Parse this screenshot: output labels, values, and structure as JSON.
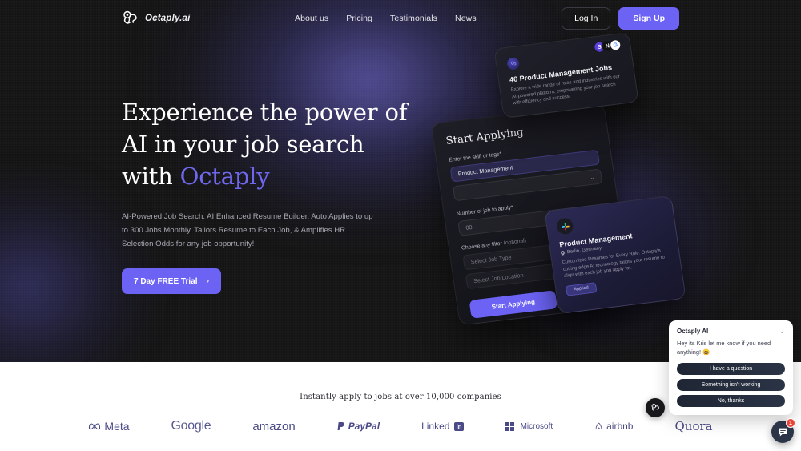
{
  "brand": {
    "name": "Octaply.ai",
    "logo_icon": "octopus-logo-icon"
  },
  "nav": {
    "links": [
      {
        "label": "About us"
      },
      {
        "label": "Pricing"
      },
      {
        "label": "Testimonials"
      },
      {
        "label": "News"
      }
    ],
    "login_label": "Log In",
    "signup_label": "Sign Up"
  },
  "hero": {
    "headline_line1": "Experience the power of",
    "headline_line2": "AI in your job search",
    "headline_line3_prefix": "with ",
    "headline_accent": "Octaply",
    "subcopy": "AI-Powered Job Search: AI Enhanced Resume Builder, Auto Applies to up to 300 Jobs Monthly, Tailors Resume to Each Job, & Amplifies HR Selection Odds for any job opportunity!",
    "cta_label": "7 Day FREE Trial",
    "cta_chevron": "›",
    "accent_color": "#6c63f5"
  },
  "cards": {
    "form": {
      "title": "Start Applying",
      "skill_label": "Enter the skill or tags*",
      "skill_value": "Product Management",
      "count_label": "Number of job to apply*",
      "count_value": "00",
      "filter_label": "Choose any filter",
      "filter_optional": "(optional)",
      "job_type_placeholder": "Select Job Type",
      "job_location_placeholder": "Select Job Location",
      "submit_label": "Start Applying",
      "chevron_icon": "chevron-down-icon"
    },
    "jobs": {
      "title": "46 Product Management Jobs",
      "description": "Explore a wide range of roles and industries with our AI-powered platform, empowering your job search with efficiency and success.",
      "logos": [
        "S",
        "N",
        "G"
      ]
    },
    "job": {
      "title": "Product Management",
      "location": "Berlin, Germany",
      "location_icon": "map-pin-icon",
      "description": "Customized Resumes for Every Role: Octaply's cutting-edge AI technology tailors your resume to align with each job you apply for.",
      "status": "Applied"
    }
  },
  "logos_section": {
    "title": "Instantly apply to jobs at over 10,000 companies",
    "companies": [
      {
        "name": "Meta"
      },
      {
        "name": "Google"
      },
      {
        "name": "amazon"
      },
      {
        "name": "PayPal"
      },
      {
        "name": "Linked"
      },
      {
        "name": "Microsoft"
      },
      {
        "name": "airbnb"
      },
      {
        "name": "Quora"
      }
    ],
    "linkedin_suffix": "in",
    "brand_color": "#4a4a86"
  },
  "chat": {
    "title": "Octaply AI",
    "message": "Hey its Kris let me know if you need anything! 😀",
    "collapse_icon": "chevron-down-icon",
    "buttons": [
      {
        "label": "I have a question"
      },
      {
        "label": "Something isn't working"
      },
      {
        "label": "No, thanks"
      }
    ],
    "launcher_icon": "chat-bubble-icon",
    "badge_count": "1",
    "badge_color": "#e8443a"
  },
  "fab": {
    "icon": "octopus-logo-icon"
  }
}
